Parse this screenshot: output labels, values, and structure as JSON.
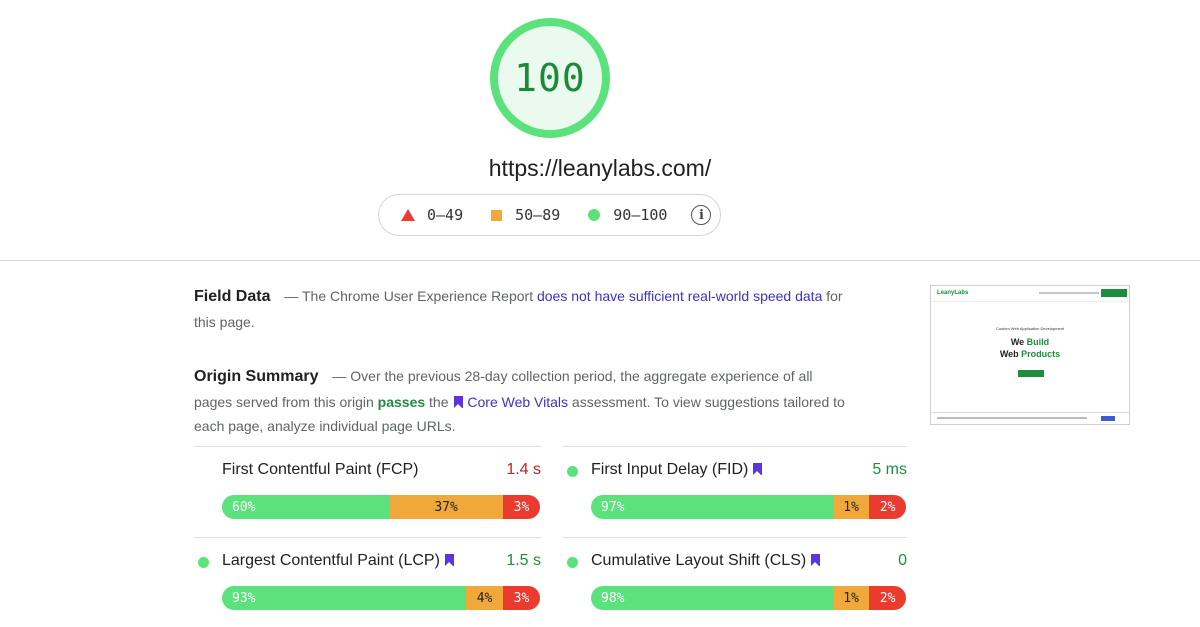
{
  "score": {
    "value": "100",
    "color": "#5ce27d"
  },
  "url": "https://leanylabs.com/",
  "legend": {
    "poor": "0–49",
    "average": "50–89",
    "good": "90–100",
    "info_icon": "info-icon"
  },
  "field_data": {
    "heading": "Field Data",
    "text_before": "— The Chrome User Experience Report",
    "link": "does not have sufficient real-world speed data",
    "text_after": "for this page."
  },
  "origin_summary": {
    "heading": "Origin Summary",
    "text_before": "— Over the previous 28-day collection period, the aggregate experience of all pages served from this origin",
    "status": "passes",
    "text_mid": "the",
    "link": "Core Web Vitals",
    "text_after": "assessment. To view suggestions tailored to each page, analyze individual page URLs."
  },
  "metrics": [
    {
      "name": "First Contentful Paint (FCP)",
      "value": "1.4 s",
      "rating": "average",
      "value_rating": "slow",
      "core": false,
      "good": 60,
      "average": 37,
      "poor": 3,
      "good_label": "60%",
      "average_label": "37%",
      "poor_label": "3%"
    },
    {
      "name": "First Input Delay (FID)",
      "value": "5 ms",
      "rating": "fast",
      "value_rating": "fast",
      "core": true,
      "good": 97,
      "average": 1,
      "poor": 2,
      "good_label": "97%",
      "average_label": "1%",
      "poor_label": "2%"
    },
    {
      "name": "Largest Contentful Paint (LCP)",
      "value": "1.5 s",
      "rating": "fast",
      "value_rating": "fast",
      "core": true,
      "good": 93,
      "average": 4,
      "poor": 3,
      "good_label": "93%",
      "average_label": "4%",
      "poor_label": "3%"
    },
    {
      "name": "Cumulative Layout Shift (CLS)",
      "value": "0",
      "rating": "fast",
      "value_rating": "fast",
      "core": true,
      "good": 98,
      "average": 1,
      "poor": 2,
      "good_label": "98%",
      "average_label": "1%",
      "poor_label": "2%"
    }
  ],
  "screenshot": {
    "logo": "LeanyLabs",
    "kicker": "Custom Web Application Development",
    "headline_1": "We",
    "headline_1_accent": "Build",
    "headline_2": "Web",
    "headline_2_accent": "Products"
  },
  "colors": {
    "good": "#5ce27d",
    "average": "#f0a83a",
    "poor": "#eb3b2f",
    "link": "#3b33c5",
    "pass": "#1e8e3e"
  }
}
